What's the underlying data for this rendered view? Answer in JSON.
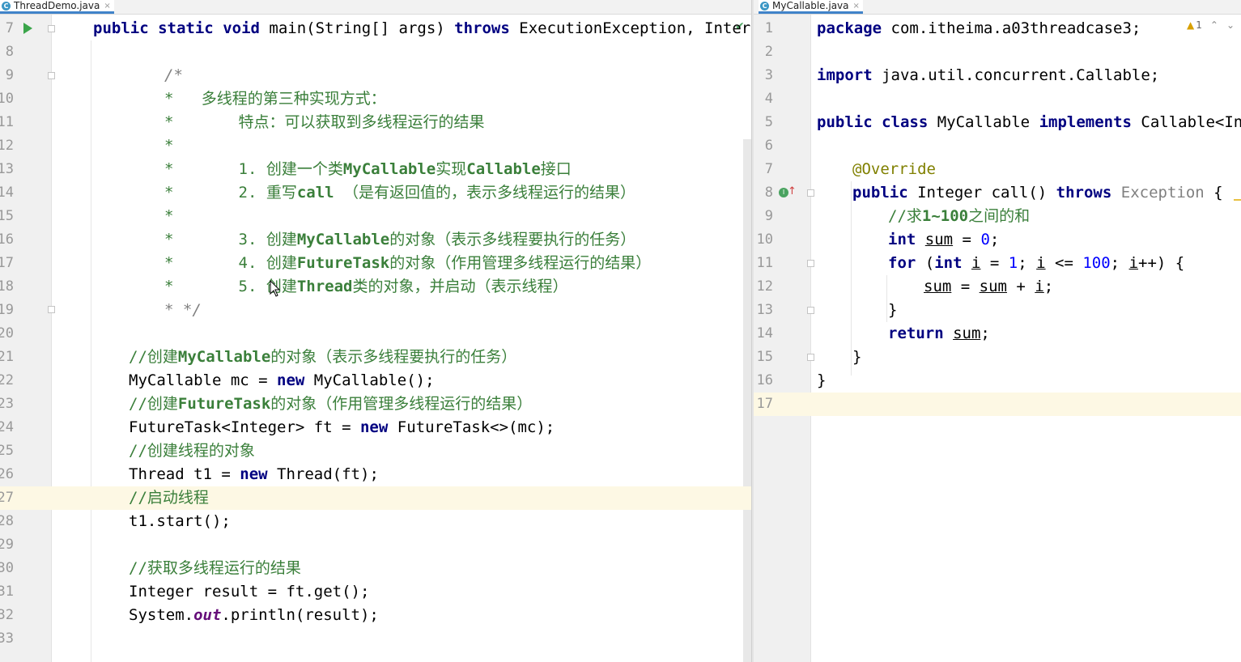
{
  "tabs": {
    "left": {
      "label": "ThreadDemo.java",
      "icon": "class-icon",
      "close": "×"
    },
    "right": {
      "label": "MyCallable.java",
      "icon": "class-icon",
      "close": "×"
    }
  },
  "inspection": {
    "warning_count": "1"
  },
  "left_editor": {
    "line_numbers": [
      "7",
      "8",
      "9",
      "10",
      "11",
      "12",
      "13",
      "14",
      "15",
      "16",
      "17",
      "18",
      "19",
      "20",
      "21",
      "22",
      "23",
      "24",
      "25",
      "26",
      "27",
      "28",
      "29",
      "30",
      "31",
      "32",
      "33"
    ],
    "line7": {
      "kw1": "public",
      "kw2": "static",
      "kw3": "void",
      "sig": " main(String[] args) ",
      "kw4": "throws",
      "rest": " ExecutionException, Interr"
    },
    "comment": {
      "open": "/*",
      "l10": "*   多线程的第三种实现方式：",
      "l11": "*       特点：可以获取到多线程运行的结果",
      "l12": "*",
      "l13a": "*       1. 创建一个类",
      "l13b": "MyCallable",
      "l13c": "实现",
      "l13d": "Callable",
      "l13e": "接口",
      "l14a": "*       2. 重写",
      "l14b": "call",
      "l14c": " （是有返回值的，表示多线程运行的结果）",
      "l15": "*",
      "l16a": "*       3. 创建",
      "l16b": "MyCallable",
      "l16c": "的对象（表示多线程要执行的任务）",
      "l17a": "*       4. 创建",
      "l17b": "FutureTask",
      "l17c": "的对象（作用管理多线程运行的结果）",
      "l18a": "*       5. 创建",
      "l18b": "Thread",
      "l18c": "类的对象，并启动（表示线程）",
      "close": "* */"
    },
    "l21a": "//创建",
    "l21b": "MyCallable",
    "l21c": "的对象（表示多线程要执行的任务）",
    "l22a": "MyCallable mc = ",
    "l22kw": "new",
    "l22b": " MyCallable();",
    "l23a": "//创建",
    "l23b": "FutureTask",
    "l23c": "的对象（作用管理多线程运行的结果）",
    "l24a": "FutureTask<Integer> ft = ",
    "l24kw": "new",
    "l24b": " FutureTask<>(mc);",
    "l25": "//创建线程的对象",
    "l26a": "Thread t1 = ",
    "l26kw": "new",
    "l26b": " Thread(ft);",
    "l27": "//启动线程",
    "l28": "t1.start();",
    "l30": "//获取多线程运行的结果",
    "l31": "Integer result = ft.get();",
    "l32a": "System.",
    "l32b": "out",
    "l32c": ".println(result);"
  },
  "right_editor": {
    "line_numbers": [
      "1",
      "2",
      "3",
      "4",
      "5",
      "6",
      "7",
      "8",
      "9",
      "10",
      "11",
      "12",
      "13",
      "14",
      "15",
      "16",
      "17"
    ],
    "l1kw": "package",
    "l1": " com.itheima.a03threadcase3;",
    "l3kw": "import",
    "l3": " java.util.concurrent.Callable;",
    "l5kw1": "public",
    "l5kw2": "class",
    "l5a": " MyCallable ",
    "l5kw3": "implements",
    "l5b": " Callable<Inte",
    "l7": "@Override",
    "l8kw1": "public",
    "l8a": " Integer call() ",
    "l8kw2": "throws",
    "l8b": "Exception",
    "l8c": " {",
    "l9a": "//求",
    "l9b": "1~100",
    "l9c": "之间的和",
    "l10kw": "int",
    "l10v": "sum",
    "l10a": " = ",
    "l10n": "0",
    "l10b": ";",
    "l11kw1": "for",
    "l11a": " (",
    "l11kw2": "int",
    "l11v1": "i",
    "l11b": " = ",
    "l11n1": "1",
    "l11c": "; ",
    "l11v2": "i",
    "l11d": " <= ",
    "l11n2": "100",
    "l11e": "; ",
    "l11v3": "i",
    "l11f": "++) {",
    "l12v1": "sum",
    "l12a": " = ",
    "l12v2": "sum",
    "l12b": " + ",
    "l12v3": "i",
    "l12c": ";",
    "l13": "}",
    "l14kw": "return",
    "l14v": "sum",
    "l14a": ";",
    "l15": "}",
    "l16": "}"
  }
}
